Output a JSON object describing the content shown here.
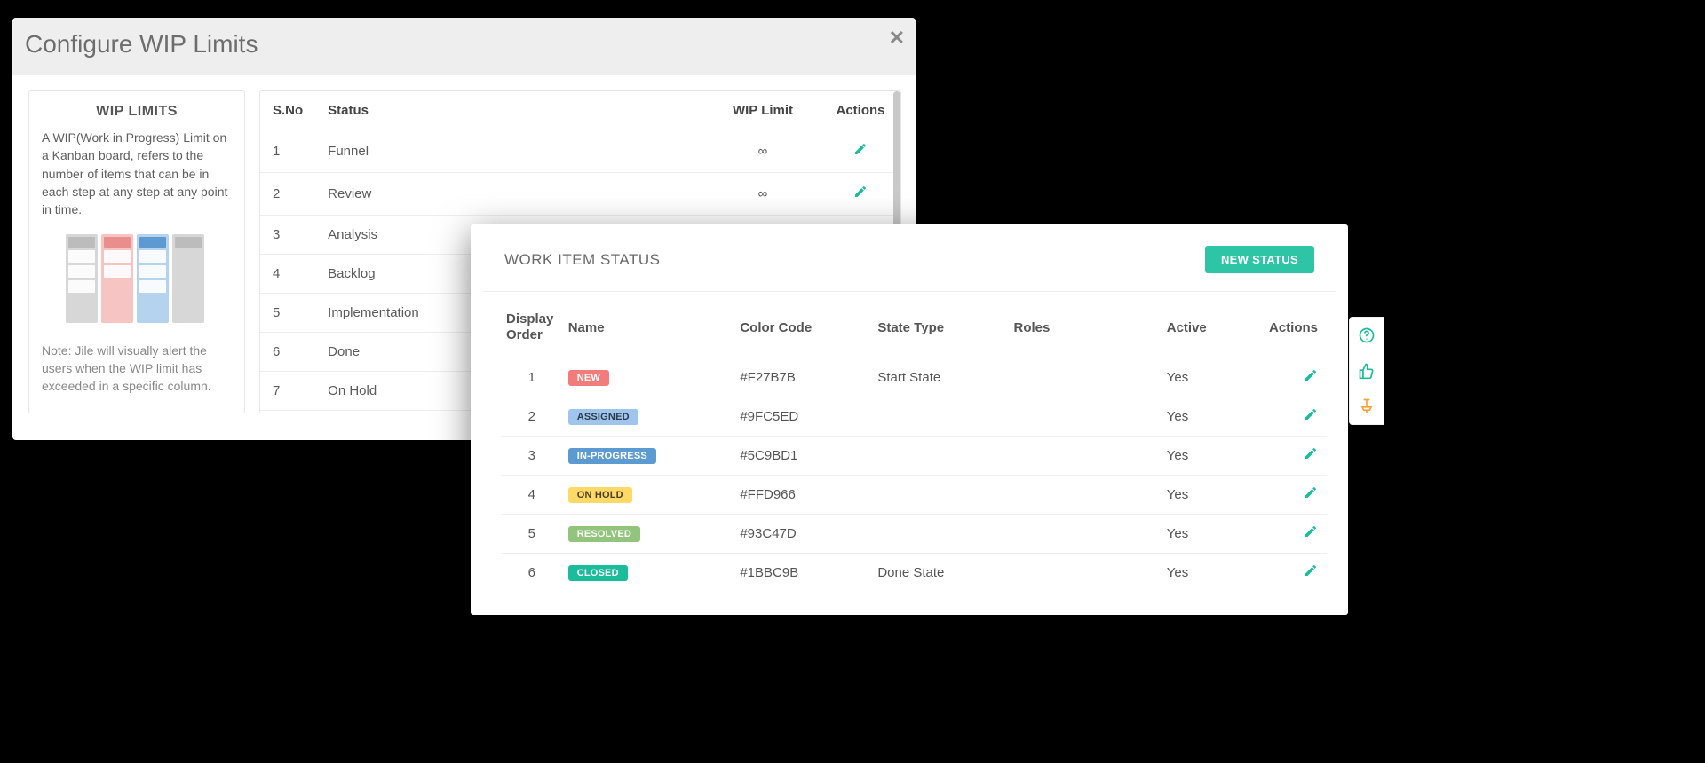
{
  "wip_modal": {
    "title": "Configure WIP Limits",
    "card_heading": "WIP LIMITS",
    "card_text": "A WIP(Work in Progress) Limit on a Kanban board, refers to the number of items that can be in each step at any step at any point in time.",
    "card_note": "Note: Jile will visually alert the users when the WIP limit has exceeded in a specific column.",
    "columns": {
      "sno": "S.No",
      "status": "Status",
      "limit": "WIP Limit",
      "actions": "Actions"
    },
    "rows": [
      {
        "n": "1",
        "status": "Funnel",
        "limit": "∞",
        "edit": true
      },
      {
        "n": "2",
        "status": "Review",
        "limit": "∞",
        "edit": true
      },
      {
        "n": "3",
        "status": "Analysis",
        "limit": "",
        "edit": false
      },
      {
        "n": "4",
        "status": "Backlog",
        "limit": "",
        "edit": false
      },
      {
        "n": "5",
        "status": "Implementation",
        "limit": "",
        "edit": false
      },
      {
        "n": "6",
        "status": "Done",
        "limit": "",
        "edit": false
      },
      {
        "n": "7",
        "status": "On Hold",
        "limit": "",
        "edit": false
      }
    ]
  },
  "status_panel": {
    "title": "WORK ITEM STATUS",
    "new_button": "NEW STATUS",
    "columns": {
      "order": "Display Order",
      "name": "Name",
      "color": "Color Code",
      "state": "State Type",
      "roles": "Roles",
      "active": "Active",
      "actions": "Actions"
    },
    "rows": [
      {
        "order": "1",
        "name": "NEW",
        "badge_bg": "#F27B7B",
        "badge_fg": "#ffffff",
        "color": "#F27B7B",
        "state": "Start State",
        "roles": "",
        "active": "Yes"
      },
      {
        "order": "2",
        "name": "ASSIGNED",
        "badge_bg": "#9FC5ED",
        "badge_fg": "#2d3b4a",
        "color": "#9FC5ED",
        "state": "",
        "roles": "",
        "active": "Yes"
      },
      {
        "order": "3",
        "name": "IN-PROGRESS",
        "badge_bg": "#5C9BD1",
        "badge_fg": "#ffffff",
        "color": "#5C9BD1",
        "state": "",
        "roles": "",
        "active": "Yes"
      },
      {
        "order": "4",
        "name": "ON HOLD",
        "badge_bg": "#FFD966",
        "badge_fg": "#4a4128",
        "color": "#FFD966",
        "state": "",
        "roles": "",
        "active": "Yes"
      },
      {
        "order": "5",
        "name": "RESOLVED",
        "badge_bg": "#93C47D",
        "badge_fg": "#ffffff",
        "color": "#93C47D",
        "state": "",
        "roles": "",
        "active": "Yes"
      },
      {
        "order": "6",
        "name": "CLOSED",
        "badge_bg": "#1BBC9B",
        "badge_fg": "#ffffff",
        "color": "#1BBC9B",
        "state": "Done State",
        "roles": "",
        "active": "Yes"
      }
    ]
  },
  "toolbar": {
    "help": "help-icon",
    "thumbs_up": "thumbs-up-icon",
    "pin": "pin-icon"
  }
}
